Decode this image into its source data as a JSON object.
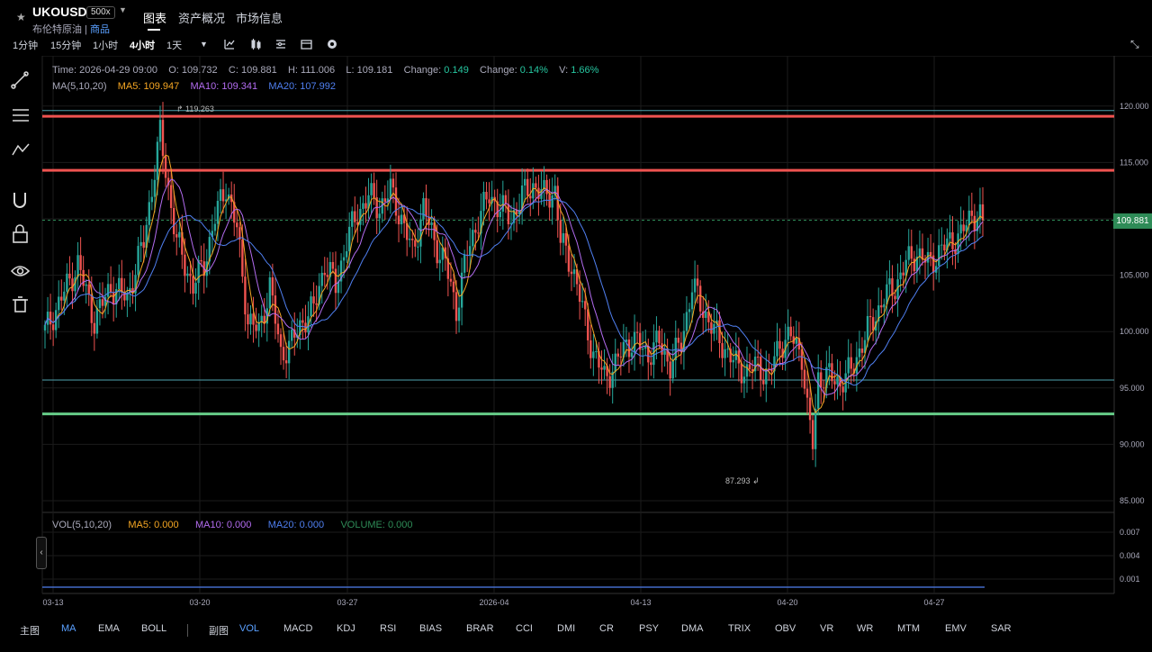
{
  "header": {
    "symbol": "UKOUSD",
    "leverage": "500x",
    "name": "布伦特原油",
    "category": "商品",
    "tabs": [
      "图表",
      "资产概况",
      "市场信息"
    ]
  },
  "timeframes": [
    "1分钟",
    "15分钟",
    "1小时",
    "4小时",
    "1天"
  ],
  "active_timeframe": "4小时",
  "toolbar_icons": [
    "indicator-icon",
    "candle-type-icon",
    "settings-list-icon",
    "calendar-icon",
    "gear-icon"
  ],
  "sidebar_icons": [
    "trendline-icon",
    "fibonacci-icon",
    "wave-icon",
    "magnet-icon",
    "lock-icon",
    "eye-icon",
    "trash-icon"
  ],
  "info_line": {
    "time": "Time: 2026-04-29 09:00",
    "open": "O: 109.732",
    "close": "C: 109.881",
    "high": "H: 111.006",
    "low": "L: 109.181",
    "change_label": "Change:",
    "change_abs": "0.149",
    "change_pct_label": "Change:",
    "change_pct": "0.14%",
    "vol_label": "V:",
    "vol": "1.66%"
  },
  "ma_line": {
    "label": "MA(5,10,20)",
    "ma5": "MA5: 109.947",
    "ma10": "MA10: 109.341",
    "ma20": "MA20: 107.992"
  },
  "vol_line": {
    "label": "VOL(5,10,20)",
    "ma5": "MA5: 0.000",
    "ma10": "MA10: 0.000",
    "ma20": "MA20: 0.000",
    "volume": "VOLUME: 0.000"
  },
  "current_price": "109.881",
  "high_marker": "119.263",
  "low_marker": "87.293",
  "bottom_main_label": "主图",
  "bottom_main": [
    "MA",
    "EMA",
    "BOLL"
  ],
  "bottom_sub_label": "副图",
  "bottom_sub": [
    "VOL",
    "MACD",
    "KDJ",
    "RSI",
    "BIAS",
    "BRAR",
    "CCI",
    "DMI",
    "CR",
    "PSY",
    "DMA",
    "TRIX",
    "OBV",
    "VR",
    "WR",
    "MTM",
    "EMV",
    "SAR"
  ],
  "colors": {
    "up": "#26a69a",
    "down": "#ef5350",
    "ma5": "#f5a623",
    "ma10": "#b36cf0",
    "ma20": "#4f7ff0",
    "accent": "#5aa0ff"
  },
  "chart_data": {
    "type": "candlestick",
    "x_ticks": [
      "03-13",
      "03-20",
      "03-27",
      "2026-04",
      "04-13",
      "04-20",
      "04-27"
    ],
    "y_ticks": [
      "120.000",
      "115.000",
      "110.000",
      "105.000",
      "100.000",
      "95.000",
      "90.000",
      "85.000"
    ],
    "vol_ticks": [
      "0.007",
      "0.004",
      "0.001"
    ],
    "ylim": [
      84,
      121.5
    ],
    "horizontal_lines": [
      {
        "value": 119.6,
        "color": "#4fa3b0"
      },
      {
        "value": 119.1,
        "color": "#ef5350"
      },
      {
        "value": 114.3,
        "color": "#ef5350"
      },
      {
        "value": 95.7,
        "color": "#4fa3b0"
      },
      {
        "value": 92.7,
        "color": "#66cc88"
      }
    ],
    "anchors": [
      [
        0,
        100
      ],
      [
        6,
        103
      ],
      [
        12,
        106
      ],
      [
        18,
        101
      ],
      [
        24,
        104
      ],
      [
        30,
        103
      ],
      [
        36,
        108
      ],
      [
        42,
        117.5
      ],
      [
        48,
        108
      ],
      [
        54,
        104
      ],
      [
        58,
        106
      ],
      [
        62,
        110
      ],
      [
        66,
        113
      ],
      [
        70,
        109
      ],
      [
        74,
        101
      ],
      [
        78,
        100
      ],
      [
        82,
        104
      ],
      [
        86,
        98
      ],
      [
        90,
        99
      ],
      [
        94,
        101
      ],
      [
        98,
        102
      ],
      [
        102,
        106
      ],
      [
        106,
        104
      ],
      [
        110,
        108
      ],
      [
        114,
        110.5
      ],
      [
        118,
        112
      ],
      [
        122,
        111
      ],
      [
        126,
        112.5
      ],
      [
        130,
        110
      ],
      [
        134,
        107
      ],
      [
        138,
        111
      ],
      [
        142,
        108
      ],
      [
        146,
        106
      ],
      [
        150,
        102
      ],
      [
        154,
        107
      ],
      [
        158,
        110
      ],
      [
        162,
        112
      ],
      [
        166,
        111
      ],
      [
        170,
        110
      ],
      [
        174,
        112
      ],
      [
        178,
        113
      ],
      [
        182,
        112
      ],
      [
        186,
        112.5
      ],
      [
        188,
        108
      ],
      [
        192,
        106
      ],
      [
        196,
        102
      ],
      [
        200,
        98
      ],
      [
        204,
        96
      ],
      [
        208,
        97
      ],
      [
        212,
        99
      ],
      [
        216,
        99
      ],
      [
        220,
        98
      ],
      [
        224,
        99
      ],
      [
        228,
        97
      ],
      [
        232,
        99
      ],
      [
        236,
        104
      ],
      [
        240,
        102
      ],
      [
        244,
        100
      ],
      [
        248,
        98.5
      ],
      [
        252,
        97
      ],
      [
        256,
        96.5
      ],
      [
        260,
        97
      ],
      [
        264,
        96
      ],
      [
        268,
        99
      ],
      [
        272,
        99.5
      ],
      [
        276,
        98
      ],
      [
        278,
        93
      ],
      [
        280,
        90
      ],
      [
        282,
        96
      ],
      [
        286,
        96
      ],
      [
        290,
        95.5
      ],
      [
        294,
        96.5
      ],
      [
        298,
        99
      ],
      [
        302,
        101
      ],
      [
        306,
        103
      ],
      [
        310,
        104
      ],
      [
        314,
        106
      ],
      [
        318,
        107
      ],
      [
        322,
        106
      ],
      [
        326,
        107
      ],
      [
        330,
        108
      ],
      [
        334,
        108.5
      ],
      [
        338,
        110.5
      ],
      [
        342,
        109.9
      ]
    ],
    "last_close": 109.881
  }
}
